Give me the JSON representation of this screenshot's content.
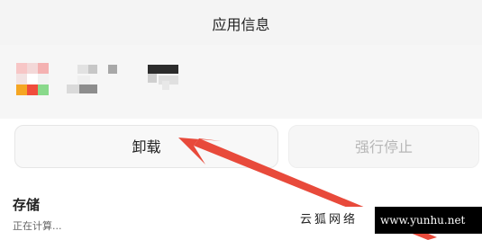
{
  "header": {
    "title": "应用信息"
  },
  "app": {
    "icon_name": "app-icon",
    "name_state": "pixelated"
  },
  "buttons": {
    "uninstall_label": "卸载",
    "force_stop_label": "强行停止"
  },
  "storage": {
    "title": "存储",
    "status": "正在计算..."
  },
  "annotation": {
    "type": "red-arrow",
    "points_to": "uninstall-button",
    "color": "#e84a3b"
  },
  "watermark": {
    "chinese": "云狐网络",
    "url": "www.yunhu.net"
  },
  "colors": {
    "header_bg": "#f4f4f4",
    "button_bg": "#f8f8f8",
    "disabled_text": "#b7b7b7",
    "arrow_red": "#e84a3b"
  }
}
